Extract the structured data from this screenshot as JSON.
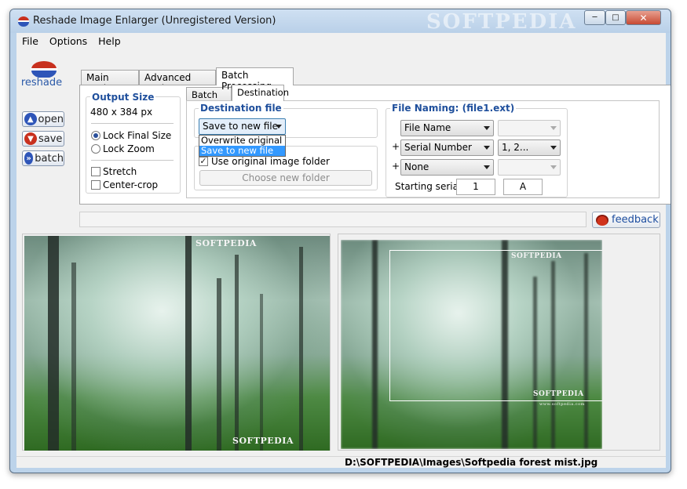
{
  "window": {
    "title": "Reshade Image Enlarger (Unregistered Version)",
    "watermark": "SOFTPEDIA"
  },
  "menu": [
    "File",
    "Options",
    "Help"
  ],
  "sidebar": {
    "logo_text": "reshade",
    "buttons": [
      {
        "label": "open",
        "color": "#2e55b8"
      },
      {
        "label": "save",
        "color": "#c8301e"
      },
      {
        "label": "batch",
        "color": "#2e55b8"
      }
    ]
  },
  "tabs": {
    "main": [
      "Main Options",
      "Advanced Options",
      "Batch Processing"
    ],
    "active_main": "Batch Processing",
    "sub": [
      "Batch List",
      "Destination"
    ],
    "active_sub": "Destination"
  },
  "output_size": {
    "title": "Output Size",
    "value": "480 x 384 px",
    "radios": [
      {
        "label": "Lock Final Size",
        "checked": true
      },
      {
        "label": "Lock Zoom",
        "checked": false
      }
    ],
    "checks": [
      {
        "label": "Stretch",
        "checked": false
      },
      {
        "label": "Center-crop",
        "checked": false
      }
    ]
  },
  "destination": {
    "title": "Destination file",
    "selected": "Save to new file",
    "options": [
      "Overwrite original",
      "Save to new file"
    ],
    "use_original_folder": {
      "label": "Use original image folder",
      "checked": true
    },
    "choose_folder_button": "Choose new folder"
  },
  "file_naming": {
    "title": "File Naming: (file1.ext)",
    "rows": [
      {
        "prefix": "",
        "field": "File Name",
        "value": "",
        "value_enabled": false
      },
      {
        "prefix": "+",
        "field": "Serial Number",
        "value": "1, 2...",
        "value_enabled": true
      },
      {
        "prefix": "+",
        "field": "None",
        "value": "",
        "value_enabled": false
      }
    ],
    "starting_serials_label": "Starting serials:",
    "serial_number": "1",
    "serial_letter": "A"
  },
  "feedback_button": "feedback",
  "preview": {
    "watermark": "SOFTPEDIA",
    "small_caption": "www.softpedia.com"
  },
  "status": {
    "path": "D:\\SOFTPEDIA\\Images\\Softpedia forest mist.jpg"
  }
}
